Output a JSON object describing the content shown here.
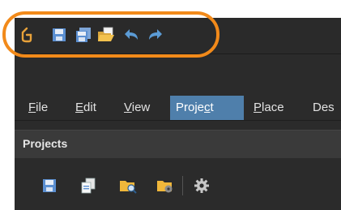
{
  "menubar": {
    "items": [
      {
        "label": "File",
        "accel": "F",
        "rest": "ile",
        "active": false
      },
      {
        "label": "Edit",
        "accel": "E",
        "rest": "dit",
        "active": false
      },
      {
        "label": "View",
        "accel": "V",
        "rest": "iew",
        "active": false
      },
      {
        "label": "Project",
        "active": true
      },
      {
        "label": "Place",
        "accel": "P",
        "rest": "lace",
        "active": false
      },
      {
        "label": "Des",
        "active": false
      }
    ]
  },
  "project_menu": {
    "pre": "Proje",
    "accel": "c",
    "post": "t"
  },
  "projects_panel": {
    "title": "Projects"
  },
  "quick_access": {
    "icons": [
      "app-logo-icon",
      "save-icon",
      "save-all-icon",
      "open-folder-icon",
      "undo-icon",
      "redo-icon"
    ]
  },
  "panel_toolbar": {
    "icons": [
      "save-icon",
      "copy-icon",
      "folder-search-icon",
      "folder-settings-icon",
      "gear-icon"
    ]
  },
  "colors": {
    "highlight": "#f28a1a",
    "menu_active": "#4f7fab",
    "undo_arrow": "#5b9bd5"
  }
}
